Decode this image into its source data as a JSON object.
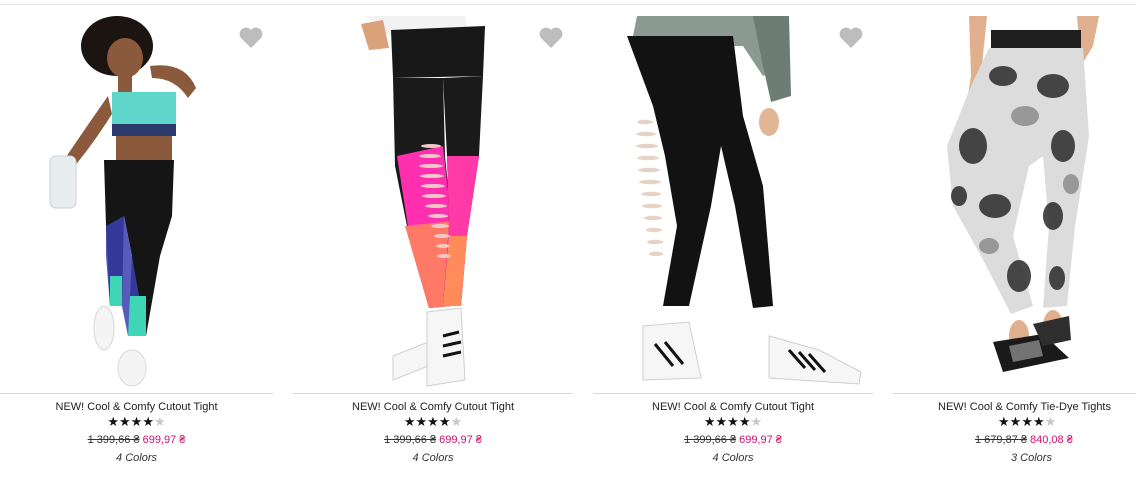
{
  "products": [
    {
      "name": "NEW! Cool & Comfy Cutout Tight",
      "rating": 4.5,
      "old_price": "1 399,66 ₴",
      "sale_price": "699,97 ₴",
      "colors_label": "4 Colors",
      "favorite_icon": "heart-icon"
    },
    {
      "name": "NEW! Cool & Comfy Cutout Tight",
      "rating": 4.5,
      "old_price": "1 399,66 ₴",
      "sale_price": "699,97 ₴",
      "colors_label": "4 Colors",
      "favorite_icon": "heart-icon"
    },
    {
      "name": "NEW! Cool & Comfy Cutout Tight",
      "rating": 4.5,
      "old_price": "1 399,66 ₴",
      "sale_price": "699,97 ₴",
      "colors_label": "4 Colors",
      "favorite_icon": "heart-icon"
    },
    {
      "name": "NEW! Cool & Comfy Tie-Dye Tights",
      "rating": 4,
      "old_price": "1 679,87 ₴",
      "sale_price": "840,08 ₴",
      "colors_label": "3 Colors"
    }
  ],
  "colors": {
    "sale_price": "#d0106e",
    "star_filled": "#111111",
    "star_empty": "#c8c8c8",
    "heart": "#bdbdbd"
  }
}
